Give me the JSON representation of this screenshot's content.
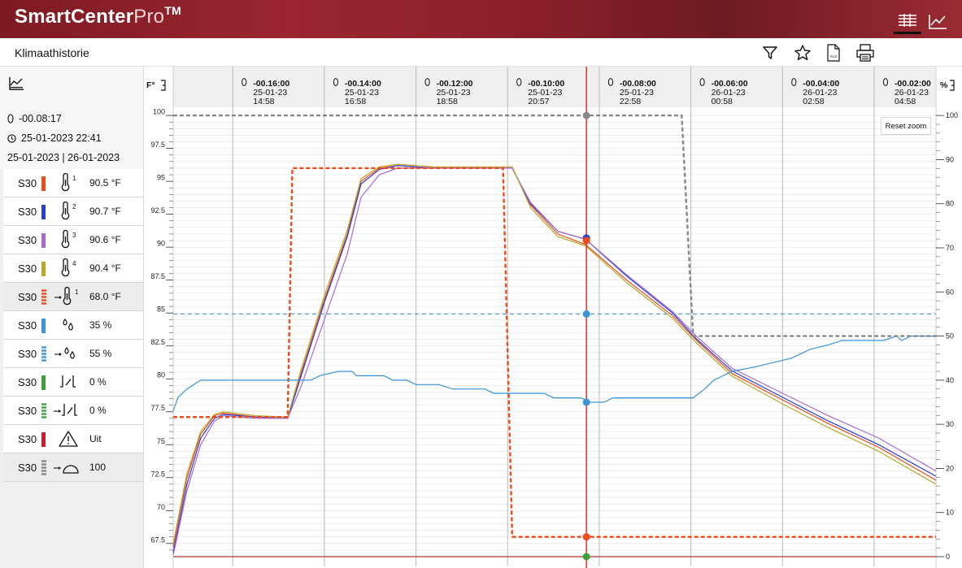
{
  "app": {
    "brand_main": "SmartCenter",
    "brand_pro": "Pro",
    "brand_tm": "TM"
  },
  "page": {
    "title": "Klimaathistorie"
  },
  "toolbar": {
    "export_label": "XLS"
  },
  "sidebar": {
    "cursor_offset": "-00.08:17",
    "cursor_datetime": "25-01-2023 22:41",
    "date_range": "25-01-2023 | 26-01-2023",
    "sensors": [
      {
        "name": "S30",
        "color": "#ee4a1a",
        "style": "solid",
        "icon": "thermometer-1-icon",
        "index": "1",
        "value": "90.5 °F"
      },
      {
        "name": "S30",
        "color": "#2a3fd6",
        "style": "solid",
        "icon": "thermometer-2-icon",
        "index": "2",
        "value": "90.7 °F"
      },
      {
        "name": "S30",
        "color": "#a86ad6",
        "style": "solid",
        "icon": "thermometer-3-icon",
        "index": "3",
        "value": "90.6 °F"
      },
      {
        "name": "S30",
        "color": "#b9a82a",
        "style": "solid",
        "icon": "thermometer-4-icon",
        "index": "4",
        "value": "90.4 °F"
      },
      {
        "name": "S30",
        "color": "#ee4a1a",
        "style": "dashed",
        "icon": "temperature-setpoint-icon",
        "index": "1",
        "value": "68.0 °F"
      },
      {
        "name": "S30",
        "color": "#3a94dc",
        "style": "solid",
        "icon": "humidity-icon",
        "index": "",
        "value": "35 %"
      },
      {
        "name": "S30",
        "color": "#3a94dc",
        "style": "dashed",
        "icon": "humidity-setpoint-icon",
        "index": "",
        "value": "55 %"
      },
      {
        "name": "S30",
        "color": "#3aa23a",
        "style": "solid",
        "icon": "valve-icon",
        "index": "",
        "value": "0 %"
      },
      {
        "name": "S30",
        "color": "#3aa23a",
        "style": "dashed",
        "icon": "valve-setpoint-icon",
        "index": "",
        "value": "0 %"
      },
      {
        "name": "S30",
        "color": "#d41a2a",
        "style": "solid",
        "icon": "warning-icon",
        "index": "",
        "value": "Uit"
      },
      {
        "name": "S30",
        "color": "#888888",
        "style": "dashed",
        "icon": "gauge-setpoint-icon",
        "index": "",
        "value": "100"
      }
    ]
  },
  "chart": {
    "left_axis_label": "F°",
    "right_axis_label": "%",
    "reset_zoom_label": "Reset zoom",
    "time_columns": [
      {
        "offset": "-00.16:00",
        "date": "25-01-23",
        "time": "14:58"
      },
      {
        "offset": "-00.14:00",
        "date": "25-01-23",
        "time": "16:58"
      },
      {
        "offset": "-00.12:00",
        "date": "25-01-23",
        "time": "18:58"
      },
      {
        "offset": "-00.10:00",
        "date": "25-01-23",
        "time": "20:57"
      },
      {
        "offset": "-00.08:00",
        "date": "25-01-23",
        "time": "22:58"
      },
      {
        "offset": "-00.06:00",
        "date": "26-01-23",
        "time": "00:58"
      },
      {
        "offset": "-00.04:00",
        "date": "26-01-23",
        "time": "02:58"
      },
      {
        "offset": "-00.02:00",
        "date": "26-01-23",
        "time": "04:58"
      }
    ]
  },
  "chart_data": {
    "type": "line",
    "x_unit": "hours relative to now",
    "xlim": [
      -17.3,
      -0.65
    ],
    "ylim_left": [
      66.5,
      100.5
    ],
    "ylim_right": [
      0,
      101.5
    ],
    "yticks_left": [
      100,
      97.5,
      95,
      92.5,
      90,
      87.5,
      85,
      82.5,
      80,
      77.5,
      75,
      72.5,
      70,
      67.5
    ],
    "yticks_right": [
      100,
      90,
      80,
      70,
      60,
      50,
      40,
      30,
      20,
      10,
      0
    ],
    "cursor_x": -8.28,
    "series": [
      {
        "id": "temp1",
        "axis": "left",
        "color": "#ee4a1a",
        "dash": false,
        "points": [
          [
            -17.3,
            67.2
          ],
          [
            -17.0,
            72.5
          ],
          [
            -16.7,
            75.8
          ],
          [
            -16.4,
            77.2
          ],
          [
            -16.2,
            77.4
          ],
          [
            -15.5,
            77.1
          ],
          [
            -14.8,
            77.0
          ],
          [
            -14.5,
            80.5
          ],
          [
            -14.0,
            86.0
          ],
          [
            -13.5,
            91.0
          ],
          [
            -13.2,
            95.0
          ],
          [
            -12.8,
            96.0
          ],
          [
            -12.4,
            96.2
          ],
          [
            -11.6,
            96.0
          ],
          [
            -10.1,
            96.0
          ],
          [
            -9.9,
            96.0
          ],
          [
            -9.5,
            93.2
          ],
          [
            -8.9,
            91.0
          ],
          [
            -8.3,
            90.2
          ],
          [
            -7.4,
            87.5
          ],
          [
            -6.4,
            84.8
          ],
          [
            -5.9,
            83.0
          ],
          [
            -5.1,
            80.4
          ],
          [
            -4.0,
            78.4
          ],
          [
            -3.0,
            76.6
          ],
          [
            -1.9,
            74.8
          ],
          [
            -0.65,
            72.3
          ]
        ]
      },
      {
        "id": "temp2",
        "axis": "left",
        "color": "#2a3fd6",
        "dash": false,
        "points": [
          [
            -17.3,
            66.8
          ],
          [
            -17.0,
            72.0
          ],
          [
            -16.7,
            75.5
          ],
          [
            -16.4,
            77.0
          ],
          [
            -16.2,
            77.3
          ],
          [
            -15.5,
            77.1
          ],
          [
            -14.8,
            77.0
          ],
          [
            -14.5,
            80.3
          ],
          [
            -14.0,
            85.8
          ],
          [
            -13.5,
            90.8
          ],
          [
            -13.2,
            94.8
          ],
          [
            -12.8,
            95.9
          ],
          [
            -12.4,
            96.2
          ],
          [
            -11.6,
            96.0
          ],
          [
            -10.1,
            96.0
          ],
          [
            -9.9,
            96.0
          ],
          [
            -9.5,
            93.3
          ],
          [
            -8.9,
            91.2
          ],
          [
            -8.3,
            90.6
          ],
          [
            -7.4,
            87.8
          ],
          [
            -6.4,
            85.0
          ],
          [
            -5.9,
            83.1
          ],
          [
            -5.1,
            80.6
          ],
          [
            -4.0,
            78.6
          ],
          [
            -3.0,
            76.8
          ],
          [
            -1.9,
            75.0
          ],
          [
            -0.65,
            72.6
          ]
        ]
      },
      {
        "id": "temp3",
        "axis": "left",
        "color": "#a86ad6",
        "dash": false,
        "points": [
          [
            -17.3,
            66.6
          ],
          [
            -17.0,
            71.5
          ],
          [
            -16.7,
            75.0
          ],
          [
            -16.4,
            76.8
          ],
          [
            -16.2,
            77.2
          ],
          [
            -15.5,
            77.0
          ],
          [
            -14.8,
            77.0
          ],
          [
            -14.5,
            79.5
          ],
          [
            -14.0,
            84.5
          ],
          [
            -13.5,
            89.5
          ],
          [
            -13.2,
            93.8
          ],
          [
            -12.8,
            95.5
          ],
          [
            -12.4,
            96.0
          ],
          [
            -11.6,
            96.0
          ],
          [
            -10.1,
            96.0
          ],
          [
            -9.9,
            96.0
          ],
          [
            -9.5,
            93.4
          ],
          [
            -8.9,
            91.2
          ],
          [
            -8.3,
            90.6
          ],
          [
            -7.4,
            87.9
          ],
          [
            -6.4,
            85.1
          ],
          [
            -5.9,
            83.3
          ],
          [
            -5.1,
            80.8
          ],
          [
            -4.0,
            78.9
          ],
          [
            -3.0,
            77.2
          ],
          [
            -1.9,
            75.5
          ],
          [
            -0.65,
            73.0
          ]
        ]
      },
      {
        "id": "temp4",
        "axis": "left",
        "color": "#b9a82a",
        "dash": false,
        "points": [
          [
            -17.3,
            67.5
          ],
          [
            -17.0,
            72.8
          ],
          [
            -16.7,
            76.0
          ],
          [
            -16.4,
            77.3
          ],
          [
            -16.2,
            77.5
          ],
          [
            -15.5,
            77.2
          ],
          [
            -14.8,
            77.1
          ],
          [
            -14.5,
            80.8
          ],
          [
            -14.0,
            86.3
          ],
          [
            -13.5,
            91.3
          ],
          [
            -13.2,
            95.2
          ],
          [
            -12.8,
            96.1
          ],
          [
            -12.4,
            96.3
          ],
          [
            -11.6,
            96.1
          ],
          [
            -10.1,
            96.1
          ],
          [
            -9.9,
            96.1
          ],
          [
            -9.5,
            93.0
          ],
          [
            -8.9,
            90.8
          ],
          [
            -8.3,
            90.1
          ],
          [
            -7.4,
            87.3
          ],
          [
            -6.4,
            84.6
          ],
          [
            -5.9,
            82.8
          ],
          [
            -5.1,
            80.2
          ],
          [
            -4.0,
            78.1
          ],
          [
            -3.0,
            76.3
          ],
          [
            -1.9,
            74.5
          ],
          [
            -0.65,
            72.0
          ]
        ]
      },
      {
        "id": "temp-setpoint",
        "axis": "left",
        "color": "#ee4a1a",
        "dash": true,
        "points": [
          [
            -17.3,
            77.1
          ],
          [
            -14.8,
            77.1
          ],
          [
            -14.7,
            96.0
          ],
          [
            -10.1,
            96.0
          ],
          [
            -9.9,
            68.0
          ],
          [
            -0.65,
            68.0
          ]
        ]
      },
      {
        "id": "humidity",
        "axis": "right",
        "color": "#3a94dc",
        "dash": false,
        "points": [
          [
            -17.3,
            33
          ],
          [
            -17.2,
            36
          ],
          [
            -17.0,
            38
          ],
          [
            -16.7,
            40
          ],
          [
            -14.3,
            40
          ],
          [
            -14.1,
            41
          ],
          [
            -13.7,
            42
          ],
          [
            -13.4,
            42
          ],
          [
            -13.3,
            41
          ],
          [
            -12.7,
            41
          ],
          [
            -12.5,
            40
          ],
          [
            -12.2,
            40
          ],
          [
            -12.0,
            39
          ],
          [
            -11.5,
            39
          ],
          [
            -11.2,
            38
          ],
          [
            -10.5,
            38
          ],
          [
            -10.3,
            37
          ],
          [
            -9.2,
            37
          ],
          [
            -9.0,
            36
          ],
          [
            -8.4,
            36
          ],
          [
            -8.2,
            35
          ],
          [
            -7.9,
            35
          ],
          [
            -7.7,
            36
          ],
          [
            -5.95,
            36
          ],
          [
            -5.7,
            38
          ],
          [
            -5.5,
            40
          ],
          [
            -5.1,
            42
          ],
          [
            -4.6,
            43
          ],
          [
            -4.2,
            44
          ],
          [
            -3.8,
            45
          ],
          [
            -3.4,
            47
          ],
          [
            -3.0,
            48
          ],
          [
            -2.7,
            49
          ],
          [
            -2.2,
            49
          ],
          [
            -1.8,
            49
          ],
          [
            -1.5,
            50
          ],
          [
            -1.4,
            49
          ],
          [
            -1.2,
            50
          ],
          [
            -0.65,
            50
          ]
        ]
      },
      {
        "id": "humidity-setpoint",
        "axis": "right",
        "color": "#3a94dc",
        "dash": true,
        "points": [
          [
            -17.3,
            55
          ],
          [
            -0.65,
            55
          ]
        ]
      },
      {
        "id": "gauge-setpoint",
        "axis": "right",
        "color": "#888888",
        "dash": true,
        "points": [
          [
            -17.3,
            100
          ],
          [
            -6.2,
            100
          ],
          [
            -5.95,
            50
          ],
          [
            -0.65,
            50
          ]
        ]
      },
      {
        "id": "valve",
        "axis": "right",
        "color": "#3aa23a",
        "dash": false,
        "points": [
          [
            -17.3,
            0
          ],
          [
            -0.65,
            0
          ]
        ]
      },
      {
        "id": "alarm",
        "axis": "right",
        "color": "#d41a2a",
        "dash": false,
        "points": [
          [
            -17.3,
            0
          ],
          [
            -0.65,
            0
          ]
        ]
      }
    ],
    "cursor_markers": [
      {
        "axis": "right",
        "value": 100,
        "color": "#888888"
      },
      {
        "axis": "left",
        "value": 90.7,
        "color": "#2a3fd6"
      },
      {
        "axis": "left",
        "value": 90.5,
        "color": "#ee4a1a"
      },
      {
        "axis": "right",
        "value": 55,
        "color": "#3a94dc"
      },
      {
        "axis": "right",
        "value": 35,
        "color": "#3a94dc"
      },
      {
        "axis": "left",
        "value": 68.0,
        "color": "#ee4a1a"
      },
      {
        "axis": "right",
        "value": 0,
        "color": "#3aa23a"
      }
    ]
  }
}
